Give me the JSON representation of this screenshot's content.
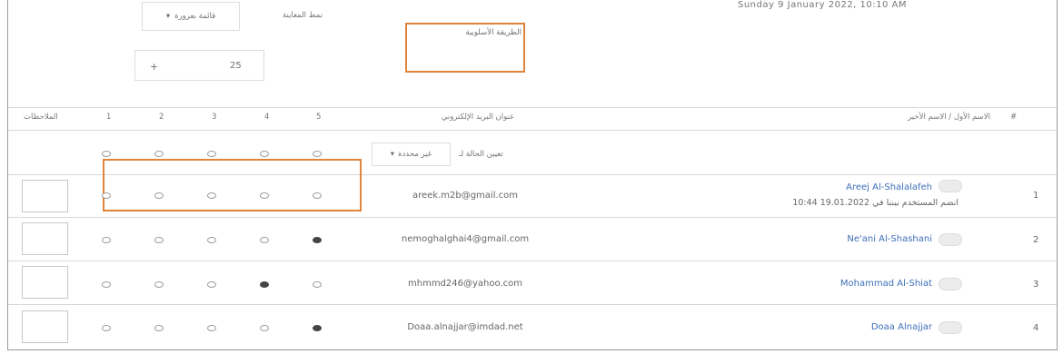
{
  "header": {
    "top_right_text": "Sunday 9 January 2022, 10:10 AM",
    "status_label": "نمط المعاينة",
    "status_select_value": "قائمة بعرورة",
    "method_label": "الطريقة الأسلوبية",
    "number_value": "25",
    "number_prefix": "+"
  },
  "table": {
    "columns": {
      "index": "#",
      "name": "الاسم الأول / الاسم الأخير",
      "email": "عنوان البريد الإلكتروني",
      "c5": "5",
      "c4": "4",
      "c3": "3",
      "c2": "2",
      "c1": "1",
      "notes": "الملاحظات"
    },
    "bulk": {
      "label": "تعيين الحالة لـ",
      "select_value": "غير محددة"
    },
    "rows": [
      {
        "num": "1",
        "name": "Areej Al-Shalalafeh",
        "sub": "انضم المستخدم بيننا في 19.01.2022 10:44",
        "email": "areek.m2b@gmail.com"
      },
      {
        "num": "2",
        "name": "Ne'ani Al-Shashani",
        "email": "nemoghalghai4@gmail.com"
      },
      {
        "num": "3",
        "name": "Mohammad Al-Shiat",
        "email": "mhmmd246@yahoo.com"
      },
      {
        "num": "4",
        "name": "Doaa Alnajjar",
        "email": "Doaa.alnajjar@imdad.net"
      }
    ]
  },
  "colors": {
    "accent": "#e0843c",
    "link": "#3d6fb8"
  }
}
